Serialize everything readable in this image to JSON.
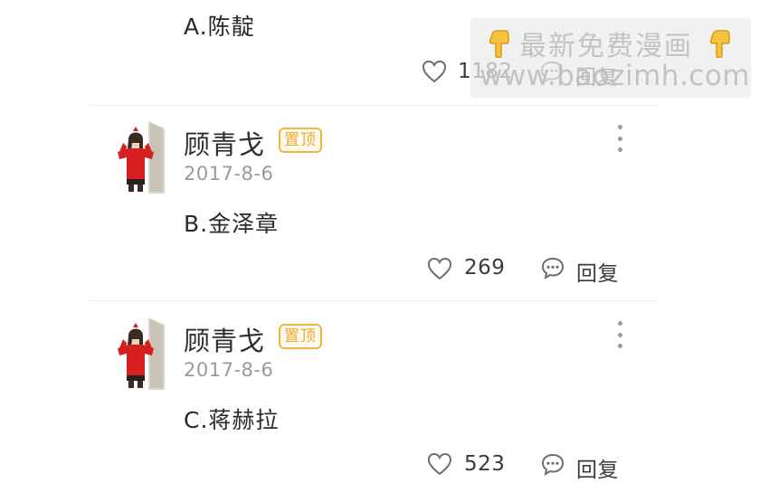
{
  "comments": [
    {
      "text": "A.陈靛",
      "likes": "1182",
      "reply_label": "回复"
    },
    {
      "username": "顾青戈",
      "badge": "置顶",
      "date": "2017-8-6",
      "text": "B.金泽章",
      "likes": "269",
      "reply_label": "回复"
    },
    {
      "username": "顾青戈",
      "badge": "置顶",
      "date": "2017-8-6",
      "text": "C.蒋赫拉",
      "likes": "523",
      "reply_label": "回复"
    }
  ],
  "watermark": {
    "line1": "最新免费漫画",
    "line2": "www.baozimh.com"
  },
  "colors": {
    "badge": "#f0aa2e",
    "avatar_shirt": "#d62020",
    "meta_text": "#9a9a9a"
  },
  "icons": [
    "heart-icon",
    "comment-bubble-icon",
    "more-vertical-icon",
    "pointing-down-hand-icon",
    "avatar-illustration"
  ]
}
